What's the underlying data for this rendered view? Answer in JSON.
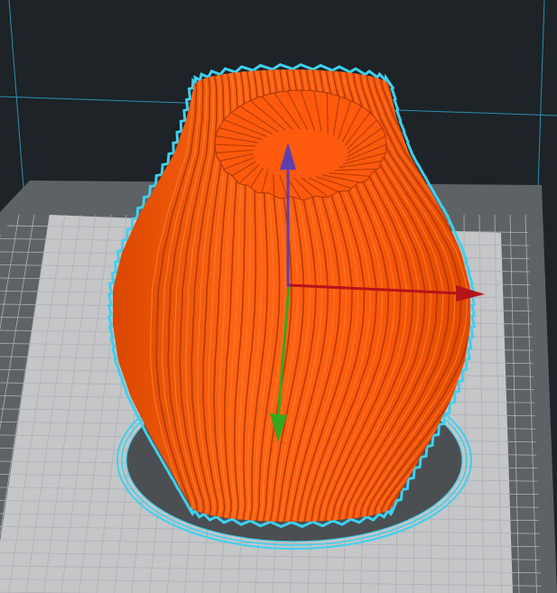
{
  "app": {
    "view": "3d-viewport",
    "selection_outline": "active"
  },
  "colors": {
    "background": "#1d2327",
    "plate_outer": "#5d6265",
    "plate_inner": "#c4c6c8",
    "grid_line": "#aeb1b3",
    "volume_line": "#2a8fae",
    "model_fill": "#ff5a0d",
    "model_shadow": "#a83600",
    "model_highlight": "#ff7a2a",
    "selection_outline": "#3fd0ef",
    "brim_fill": "#4b4f52",
    "axis_x": "#b5131a",
    "axis_y": "#35a81d",
    "axis_z": "#5f3fb0"
  },
  "icons": {
    "move_x": "red-arrow-x-axis",
    "move_y": "green-arrow-y-axis",
    "move_z": "purple-arrow-z-axis"
  }
}
